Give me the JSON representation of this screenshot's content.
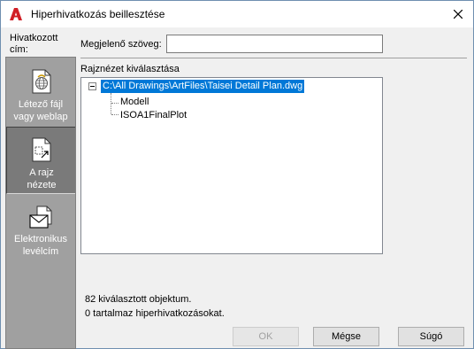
{
  "window": {
    "title": "Hiperhivatkozás beillesztése",
    "icon": "autocad-a-icon",
    "accent_color": "#d11f26"
  },
  "sidebar": {
    "caption": "Hivatkozott cím:",
    "items": [
      {
        "label_line1": "Létező fájl",
        "label_line2": "vagy weblap",
        "icon": "file-globe-icon",
        "selected": false
      },
      {
        "label_line1": "A rajz",
        "label_line2": "nézete",
        "icon": "drawing-view-icon",
        "selected": true
      },
      {
        "label_line1": "Elektronikus",
        "label_line2": "levélcím",
        "icon": "email-icon",
        "selected": false
      }
    ]
  },
  "display_text": {
    "label": "Megjelenő szöveg:",
    "value": ""
  },
  "view_select": {
    "label": "Rajznézet kiválasztása",
    "tree": {
      "root": "C:\\All Drawings\\ArtFiles\\Taisei Detail Plan.dwg",
      "children": [
        "Modell",
        "ISOA1FinalPlot"
      ]
    }
  },
  "status": {
    "line1": "82 kiválasztott objektum.",
    "line2": "0 tartalmaz hiperhivatkozásokat."
  },
  "buttons": {
    "ok": "OK",
    "cancel": "Mégse",
    "help": "Súgó"
  },
  "colors": {
    "selection": "#0078d7",
    "sidebar": "#a0a0a0",
    "sidebar_selected": "#7a7a7a"
  }
}
